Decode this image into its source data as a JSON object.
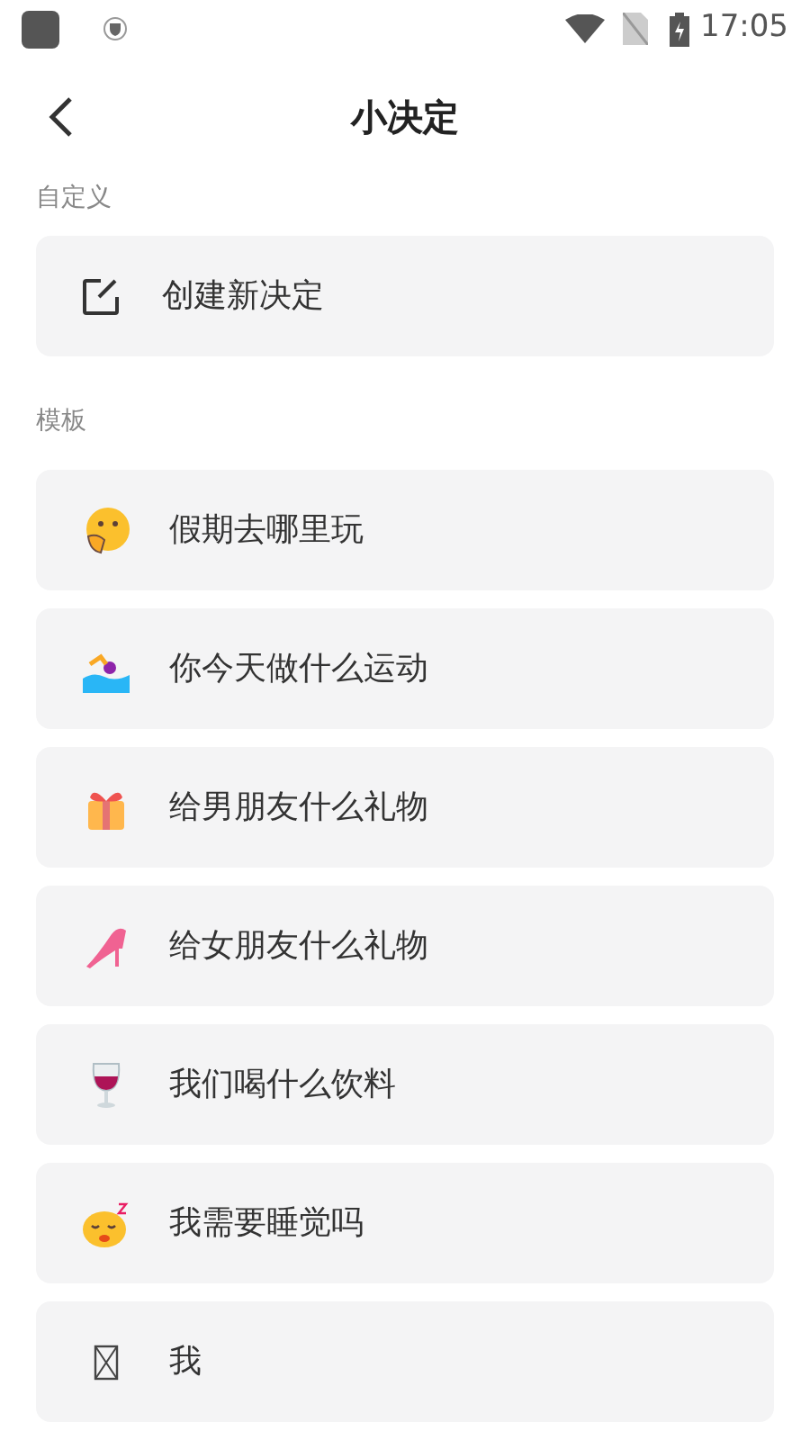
{
  "status_bar": {
    "time": "17:05"
  },
  "header": {
    "title": "小决定"
  },
  "custom_section": {
    "label": "自定义",
    "item": "创建新决定"
  },
  "template_section": {
    "label": "模板",
    "items": [
      {
        "label": "假期去哪里玩"
      },
      {
        "label": "你今天做什么运动"
      },
      {
        "label": "给男朋友什么礼物"
      },
      {
        "label": "给女朋友什么礼物"
      },
      {
        "label": "我们喝什么饮料"
      },
      {
        "label": "我需要睡觉吗"
      },
      {
        "label": "我"
      }
    ]
  }
}
